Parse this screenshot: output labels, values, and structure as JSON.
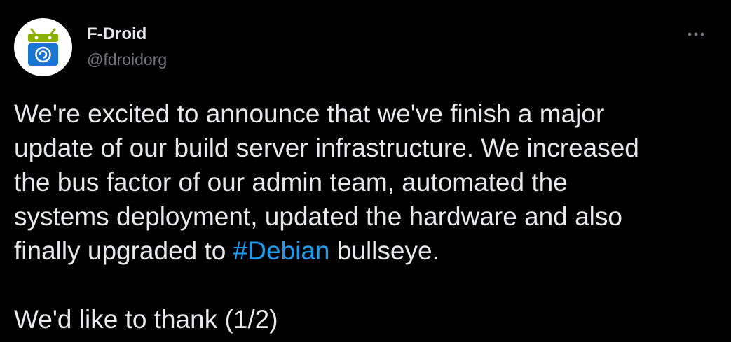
{
  "author": {
    "display_name": "F-Droid",
    "handle": "@fdroidorg",
    "avatar_icon": "fdroid-logo-icon"
  },
  "menu": {
    "icon": "more-horizontal-icon"
  },
  "tweet": {
    "line1": "We're excited to announce that we've finish a major",
    "line2": "update of our build server infrastructure. We increased",
    "line3": "the bus factor of our admin team, automated the",
    "line4": "systems deployment, updated the hardware and also",
    "line5_before": "finally upgraded to ",
    "hashtag": "#Debian",
    "line5_after": " bullseye.",
    "line7": "We'd like to thank (1/2)"
  },
  "colors": {
    "background": "#000000",
    "text": "#e7e9ea",
    "secondary_text": "#71767b",
    "link": "#1d9bf0",
    "logo_green": "#8ab000",
    "logo_blue": "#1976d2"
  }
}
